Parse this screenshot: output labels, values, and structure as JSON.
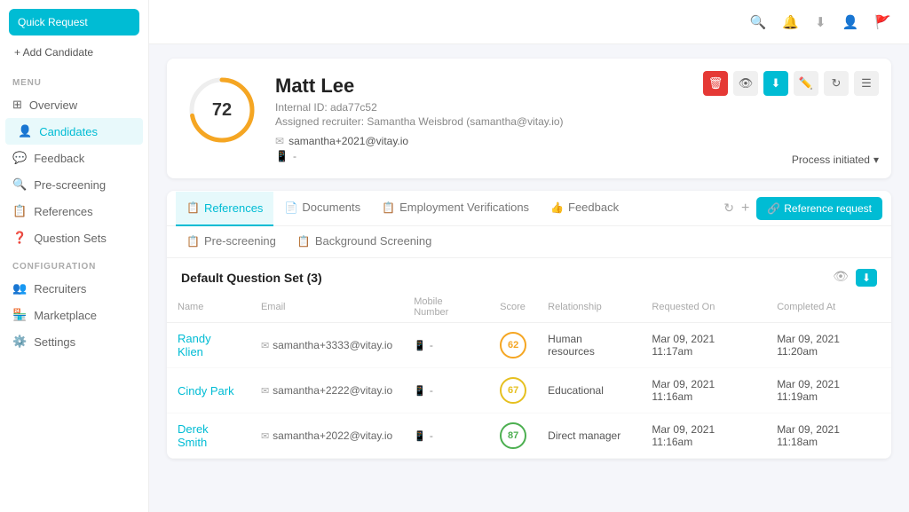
{
  "sidebar": {
    "quick_request": "Quick Request",
    "add_candidate": "+ Add Candidate",
    "menu_label": "MENU",
    "config_label": "CONFIGURATION",
    "menu_items": [
      {
        "label": "Overview",
        "icon": "grid-icon",
        "active": false
      },
      {
        "label": "Candidates",
        "icon": "person-icon",
        "active": true
      },
      {
        "label": "Feedback",
        "icon": "feedback-icon",
        "active": false
      },
      {
        "label": "Pre-screening",
        "icon": "prescreening-icon",
        "active": false
      },
      {
        "label": "References",
        "icon": "ref-icon",
        "active": false
      },
      {
        "label": "Question Sets",
        "icon": "question-icon",
        "active": false
      }
    ],
    "config_items": [
      {
        "label": "Recruiters",
        "icon": "recruiter-icon"
      },
      {
        "label": "Marketplace",
        "icon": "marketplace-icon"
      },
      {
        "label": "Settings",
        "icon": "settings-icon"
      }
    ]
  },
  "topbar": {
    "icons": [
      "search-icon",
      "bell-icon",
      "download-icon",
      "user-icon",
      "flag-icon"
    ]
  },
  "candidate": {
    "name": "Matt Lee",
    "internal_id": "Internal ID: ada77c52",
    "recruiter": "Assigned recruiter: Samantha Weisbrod (samantha@vitay.io)",
    "email": "samantha+2021@vitay.io",
    "phone": "-",
    "score": 72,
    "process_status": "Process initiated"
  },
  "tabs": {
    "row1": [
      {
        "label": "References",
        "icon": "📋",
        "active": true
      },
      {
        "label": "Documents",
        "icon": "📄",
        "active": false
      },
      {
        "label": "Employment Verifications",
        "icon": "📋",
        "active": false
      },
      {
        "label": "Feedback",
        "icon": "👍",
        "active": false
      }
    ],
    "row2": [
      {
        "label": "Pre-screening",
        "icon": "📋",
        "active": false
      },
      {
        "label": "Background Screening",
        "icon": "📋",
        "active": false
      }
    ],
    "ref_request_btn": "Reference request"
  },
  "table": {
    "title": "Default Question Set (3)",
    "columns": [
      "Name",
      "Email",
      "Mobile Number",
      "Score",
      "Relationship",
      "Requested On",
      "Completed At"
    ],
    "rows": [
      {
        "name": "Randy Klien",
        "email": "samantha+3333@vitay.io",
        "phone": "-",
        "score": 62,
        "score_class": "score-62",
        "relationship": "Human resources",
        "requested": "Mar 09, 2021 11:17am",
        "completed": "Mar 09, 2021 11:20am"
      },
      {
        "name": "Cindy Park",
        "email": "samantha+2222@vitay.io",
        "phone": "-",
        "score": 67,
        "score_class": "score-67",
        "relationship": "Educational",
        "requested": "Mar 09, 2021 11:16am",
        "completed": "Mar 09, 2021 11:19am"
      },
      {
        "name": "Derek Smith",
        "email": "samantha+2022@vitay.io",
        "phone": "-",
        "score": 87,
        "score_class": "score-87",
        "relationship": "Direct manager",
        "requested": "Mar 09, 2021 11:16am",
        "completed": "Mar 09, 2021 11:18am"
      }
    ]
  }
}
